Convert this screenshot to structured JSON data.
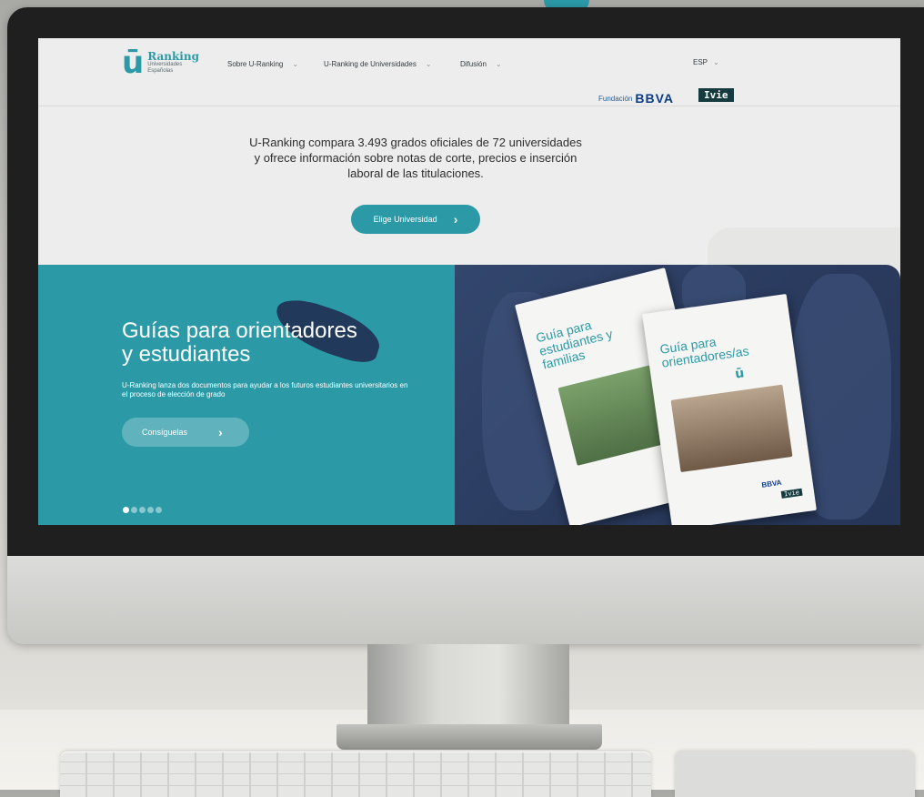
{
  "site": {
    "logo": {
      "mark": "ū",
      "title": "Ranking",
      "subtitle_line1": "Universidades",
      "subtitle_line2": "Españolas"
    },
    "nav": [
      {
        "label": "Sobre U-Ranking"
      },
      {
        "label": "U-Ranking de Universidades"
      },
      {
        "label": "Difusión"
      }
    ],
    "language": "ESP",
    "partners": {
      "fundacion": "Fundación",
      "bbva": "BBVA",
      "ivie": "Ivie"
    }
  },
  "hero": {
    "text": "U-Ranking compara 3.493 grados oficiales de 72 universidades y ofrece información sobre notas de corte, precios e inserción laboral de las titulaciones.",
    "cta_label": "Elige Universidad"
  },
  "banner": {
    "title_line1": "Guías para orientadores",
    "title_line2": "y estudiantes",
    "description": "U-Ranking lanza dos documentos para ayudar a los futuros estudiantes universitarios en el proceso de elección de grado",
    "button_label": "Consíguelas",
    "slides": 5,
    "active_slide": 1,
    "books": [
      {
        "title_line1": "Guía para",
        "title_line2": "estudiantes y familias"
      },
      {
        "title_line1": "Guía para",
        "title_line2": "orientadores/as"
      }
    ]
  },
  "colors": {
    "accent": "#2b9aa6",
    "banner_right": "#2a3b5f",
    "brand_blue": "#0d3c86"
  },
  "icons": [
    "chevron-down-icon",
    "chevron-right-icon",
    "slide-dot-icon"
  ]
}
